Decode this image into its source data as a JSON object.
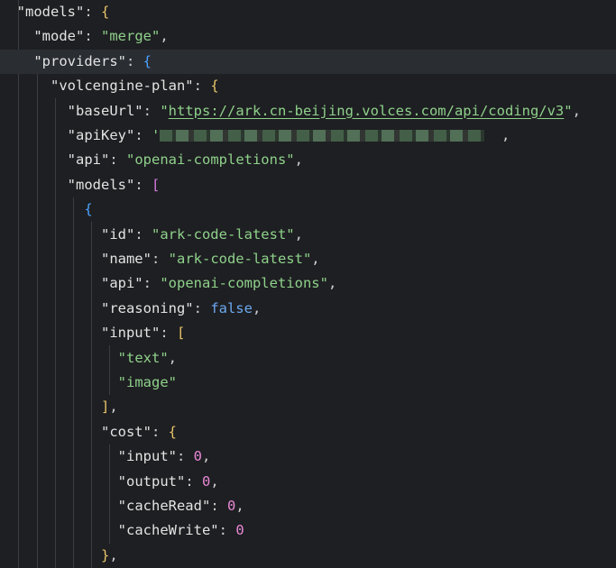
{
  "code": {
    "models_key": "\"models\"",
    "mode_key": "\"mode\"",
    "mode_value": "\"merge\"",
    "providers_key": "\"providers\"",
    "provider_name_key": "\"volcengine-plan\"",
    "baseUrl_key": "\"baseUrl\"",
    "baseUrl_value": "https://ark.cn-beijing.volces.com/api/coding/v3",
    "apiKey_key": "\"apiKey\"",
    "api_key": "\"api\"",
    "api_value": "\"openai-completions\"",
    "models_list_key": "\"models\"",
    "id_key": "\"id\"",
    "id_value": "\"ark-code-latest\"",
    "name_key": "\"name\"",
    "name_value": "\"ark-code-latest\"",
    "model_api_key": "\"api\"",
    "model_api_value": "\"openai-completions\"",
    "reasoning_key": "\"reasoning\"",
    "reasoning_value": "false",
    "input_key": "\"input\"",
    "input_item_1": "\"text\"",
    "input_item_2": "\"image\"",
    "cost_key": "\"cost\"",
    "cost_input_key": "\"input\"",
    "cost_input_value": "0",
    "cost_output_key": "\"output\"",
    "cost_output_value": "0",
    "cacheRead_key": "\"cacheRead\"",
    "cacheRead_value": "0",
    "cacheWrite_key": "\"cacheWrite\"",
    "cacheWrite_value": "0"
  },
  "colors": {
    "background": "#1e1f22",
    "current_line": "#2a2d32",
    "string": "#8fd18b",
    "number": "#e888d6",
    "boolean": "#6ca9f0",
    "bracket_level_1": "#e9c46a",
    "bracket_level_2": "#d37adf",
    "bracket_level_3": "#4aa3ff"
  }
}
